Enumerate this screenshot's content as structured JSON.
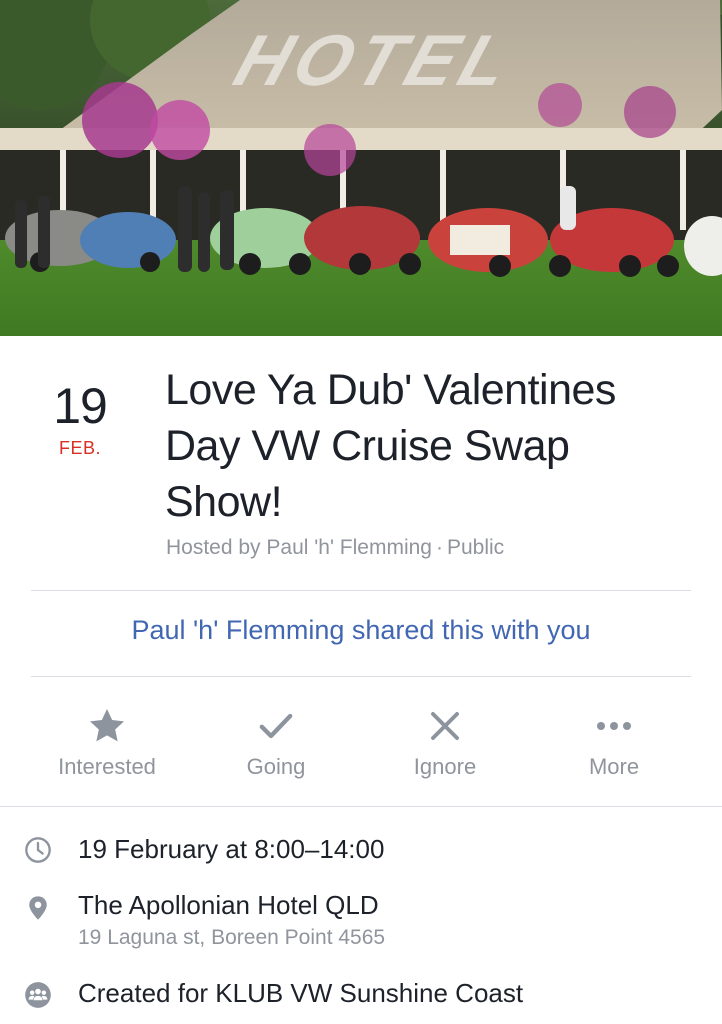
{
  "cover": {
    "sign_text": "HOTEL"
  },
  "event": {
    "day": "19",
    "month": "FEB.",
    "title_lines": [
      "Love Ya Dub' Valentines",
      "Day VW Cruise Swap",
      "Show!"
    ],
    "host": "Hosted by Paul 'h' Flemming",
    "visibility": "Public"
  },
  "shared_notice": "Paul 'h' Flemming shared this with you",
  "actions": [
    {
      "label": "Interested",
      "icon": "star-icon"
    },
    {
      "label": "Going",
      "icon": "check-icon"
    },
    {
      "label": "Ignore",
      "icon": "close-icon"
    },
    {
      "label": "More",
      "icon": "more-dots-icon"
    }
  ],
  "details": {
    "time": {
      "text": "19 February at 8:00–14:00",
      "icon": "clock-icon"
    },
    "location": {
      "name": "The Apollonian Hotel QLD",
      "address": "19 Laguna st, Boreen Point 4565",
      "icon": "location-pin-icon"
    },
    "group": {
      "text": "Created for KLUB VW Sunshine Coast",
      "icon": "group-icon"
    }
  },
  "colors": {
    "accent_blue": "#4267b2",
    "month_red": "#d93025",
    "secondary_gray": "#90949c",
    "icon_gray": "#8d949e",
    "divider": "#dadde1"
  }
}
